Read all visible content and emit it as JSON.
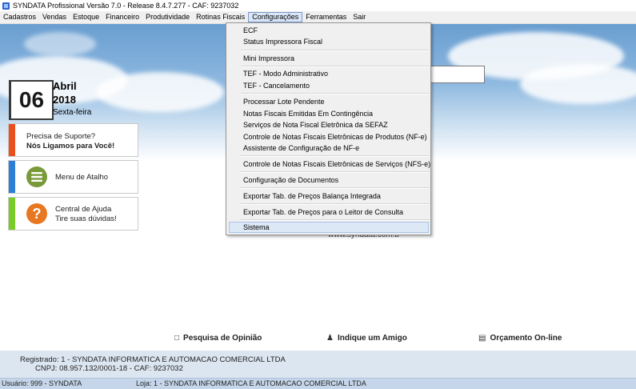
{
  "window": {
    "title": "SYNDATA Profissional Versão 7.0 - Release 8.4.7.277 - CAF: 9237032"
  },
  "menubar": {
    "items": [
      "Cadastros",
      "Vendas",
      "Estoque",
      "Financeiro",
      "Produtividade",
      "Rotinas Fiscais",
      "Configurações",
      "Ferramentas",
      "Sair"
    ],
    "active": "Configurações"
  },
  "date": {
    "day": "06",
    "month": "Abril",
    "year": "2018",
    "weekday": "Sexta-feira"
  },
  "cards": {
    "support": {
      "line1": "Precisa de Suporte?",
      "line2": "Nós Ligamos para Você!",
      "color": "#e8501e"
    },
    "shortcut": {
      "label": "Menu de Atalho",
      "color": "#2d7fd6",
      "icon": "menu-lines-icon",
      "icon_color": "#7a9a3a"
    },
    "help": {
      "line1": "Central de Ajuda",
      "line2": "Tire suas dúvidas!",
      "color": "#7acb2a",
      "icon": "question-icon",
      "icon_color": "#e87722"
    }
  },
  "dropdown": {
    "items": [
      {
        "label": "ECF"
      },
      {
        "label": "Status Impressora Fiscal"
      },
      {
        "label": "Mini Impressora"
      },
      {
        "label": "TEF - Modo Administrativo"
      },
      {
        "label": "TEF - Cancelamento"
      },
      {
        "label": "Processar Lote Pendente"
      },
      {
        "label": "Notas Fiscais Emitidas Em Contingência"
      },
      {
        "label": "Serviços de Nota Fiscal Eletrônica da SEFAZ"
      },
      {
        "label": "Controle de Notas Fiscais Eletrônicas de Produtos (NF-e)"
      },
      {
        "label": "Assistente de Configuração de NF-e"
      },
      {
        "label": "Controle de Notas Fiscais Eletrônicas de Serviços (NFS-e)"
      },
      {
        "label": "Configuração de Documentos"
      },
      {
        "label": "Exportar Tab. de Preços Balança Integrada"
      },
      {
        "label": "Exportar Tab. de Preços para o Leitor de Consulta"
      },
      {
        "label": "Sistema"
      }
    ],
    "highlighted": "Sistema"
  },
  "background": {
    "url_fragment": "www.syndata.com.b"
  },
  "bottom_links": {
    "survey": "Pesquisa de Opinião",
    "refer": "Indique um Amigo",
    "quote": "Orçamento On-line"
  },
  "registration": {
    "registered_label": "Registrado:",
    "registered_value": "1 - SYNDATA INFORMATICA E AUTOMACAO COMERCIAL LTDA",
    "cnpj_label": "CNPJ:",
    "cnpj_value": "08.957.132/0001-18 - CAF: 9237032"
  },
  "status": {
    "user": "Usuário: 999 - SYNDATA",
    "store": "Loja: 1 - SYNDATA INFORMATICA E AUTOMACAO COMERCIAL LTDA"
  }
}
